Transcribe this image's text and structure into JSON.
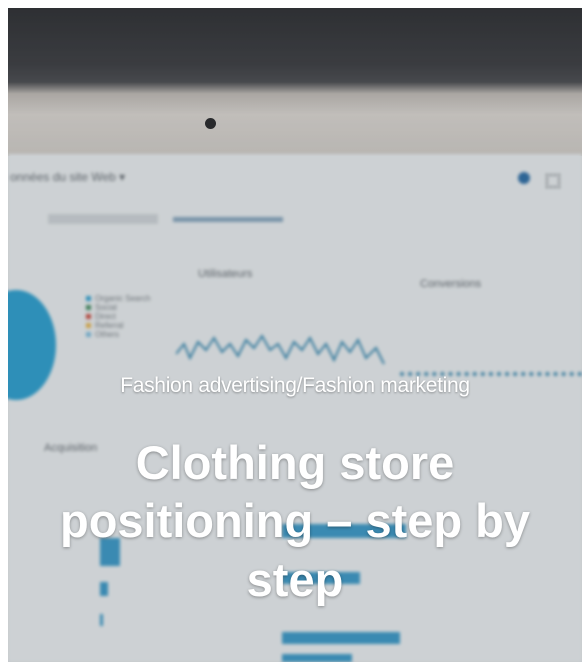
{
  "post": {
    "category": "Fashion advertising/Fashion marketing",
    "title": "Clothing store positioning – step by step"
  },
  "background_screen": {
    "header": "onnées du site Web ▾",
    "labels": [
      "Utilisateurs",
      "Conversions",
      "Acquisition"
    ],
    "legend": [
      "Organic Search",
      "Social",
      "Direct",
      "Referral",
      "Others"
    ]
  },
  "colors": {
    "accent": "#1a95c8",
    "overlay_text": "#ffffff"
  }
}
